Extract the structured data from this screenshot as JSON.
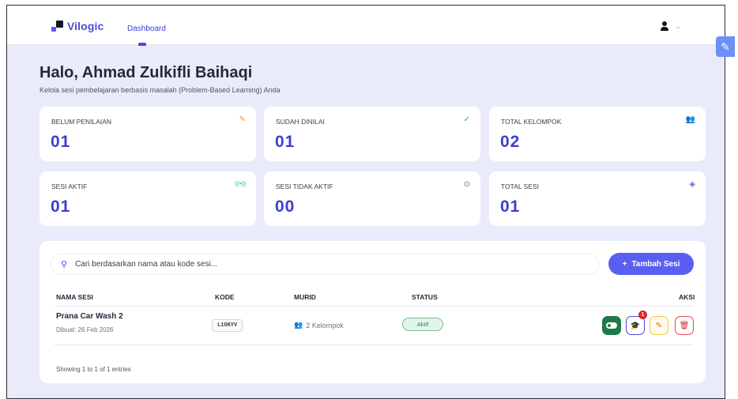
{
  "header": {
    "brand": "Vilogic",
    "nav_dashboard": "Dashboard",
    "user_chevron": "⌄"
  },
  "greeting": {
    "title": "Halo, Ahmad Zulkifli Baihaqi",
    "subtitle": "Kelola sesi pembelajaran berbasis masalah (Problem-Based Learning) Anda"
  },
  "stats": [
    {
      "label": "BELUM PENILAIAN",
      "value": "01",
      "icon": "edit-icon",
      "icon_color": "#f59e0b"
    },
    {
      "label": "SUDAH DINILAI",
      "value": "01",
      "icon": "check-icon",
      "icon_color": "#10b981"
    },
    {
      "label": "TOTAL KELOMPOK",
      "value": "02",
      "icon": "group-icon",
      "icon_color": "#6366f1"
    },
    {
      "label": "SESI AKTIF",
      "value": "01",
      "icon": "broadcast-icon",
      "icon_color": "#10b981"
    },
    {
      "label": "SESI TIDAK AKTIF",
      "value": "00",
      "icon": "stop-circle-icon",
      "icon_color": "#6b7280"
    },
    {
      "label": "TOTAL SESI",
      "value": "01",
      "icon": "layers-icon",
      "icon_color": "#6366f1"
    }
  ],
  "search": {
    "placeholder": "Cari berdasarkan nama atau kode sesi..."
  },
  "add_button": {
    "label": "Tambah Sesi"
  },
  "table": {
    "columns": [
      "NAMA SESI",
      "KODE",
      "MURID",
      "STATUS",
      "AKSI"
    ],
    "rows": [
      {
        "name": "Prana Car Wash 2",
        "created": "Dibuat: 26 Feb 2026",
        "kode": "L10KYV",
        "murid": "2 Kelompok",
        "status": "Aktif",
        "notification_count": "1"
      }
    ],
    "footer": "Showing 1 to 1 of 1 entries"
  },
  "colors": {
    "accent": "#5b5ff0",
    "background": "#e9ebfb",
    "status_active": "#2f7a4b",
    "danger": "#dc2626"
  }
}
